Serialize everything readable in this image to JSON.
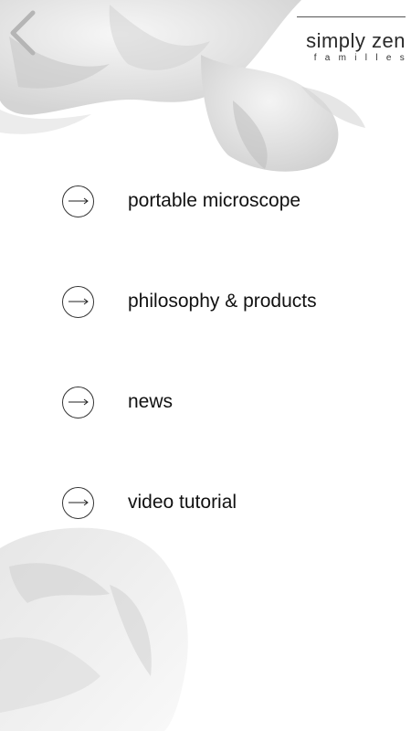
{
  "header": {
    "back_icon": "chevron-left-icon",
    "logo_title": "simply zen",
    "logo_subtitle": "familles"
  },
  "menu": {
    "arrow_icon": "arrow-right-icon",
    "items": [
      {
        "label": "portable microscope"
      },
      {
        "label": "philosophy & products"
      },
      {
        "label": "news"
      },
      {
        "label": "video tutorial"
      }
    ]
  },
  "colors": {
    "background": "#ffffff",
    "text": "#111111",
    "petal_shading": "#d9d9d9"
  }
}
